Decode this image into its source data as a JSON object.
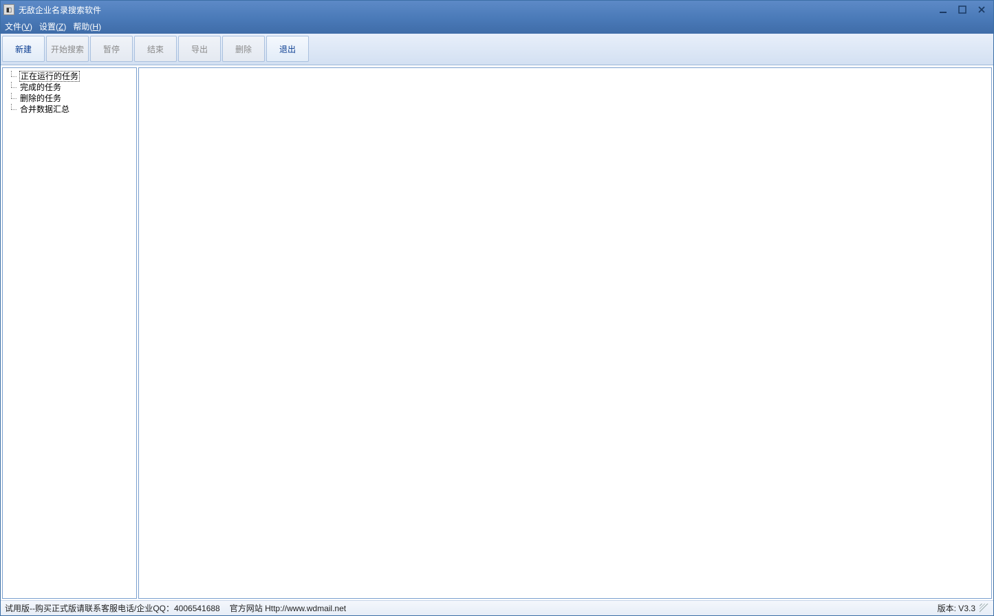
{
  "window": {
    "title": "无敌企业名录搜索软件"
  },
  "menubar": {
    "file": {
      "label": "文件",
      "accel": "V"
    },
    "settings": {
      "label": "设置",
      "accel": "Z"
    },
    "help": {
      "label": "帮助",
      "accel": "H"
    }
  },
  "toolbar": {
    "new_label": "新建",
    "start_search_label": "开始搜索",
    "pause_label": "暂停",
    "end_label": "结束",
    "export_label": "导出",
    "delete_label": "删除",
    "exit_label": "退出"
  },
  "sidebar": {
    "items": [
      {
        "label": "正在运行的任务",
        "selected": true
      },
      {
        "label": "完成的任务",
        "selected": false
      },
      {
        "label": "删除的任务",
        "selected": false
      },
      {
        "label": "合并数据汇总",
        "selected": false
      }
    ]
  },
  "statusbar": {
    "left": "试用版--购买正式版请联系客服电话/企业QQ：4006541688",
    "mid": "官方网站 Http://www.wdmail.net",
    "version": "版本: V3.3"
  }
}
